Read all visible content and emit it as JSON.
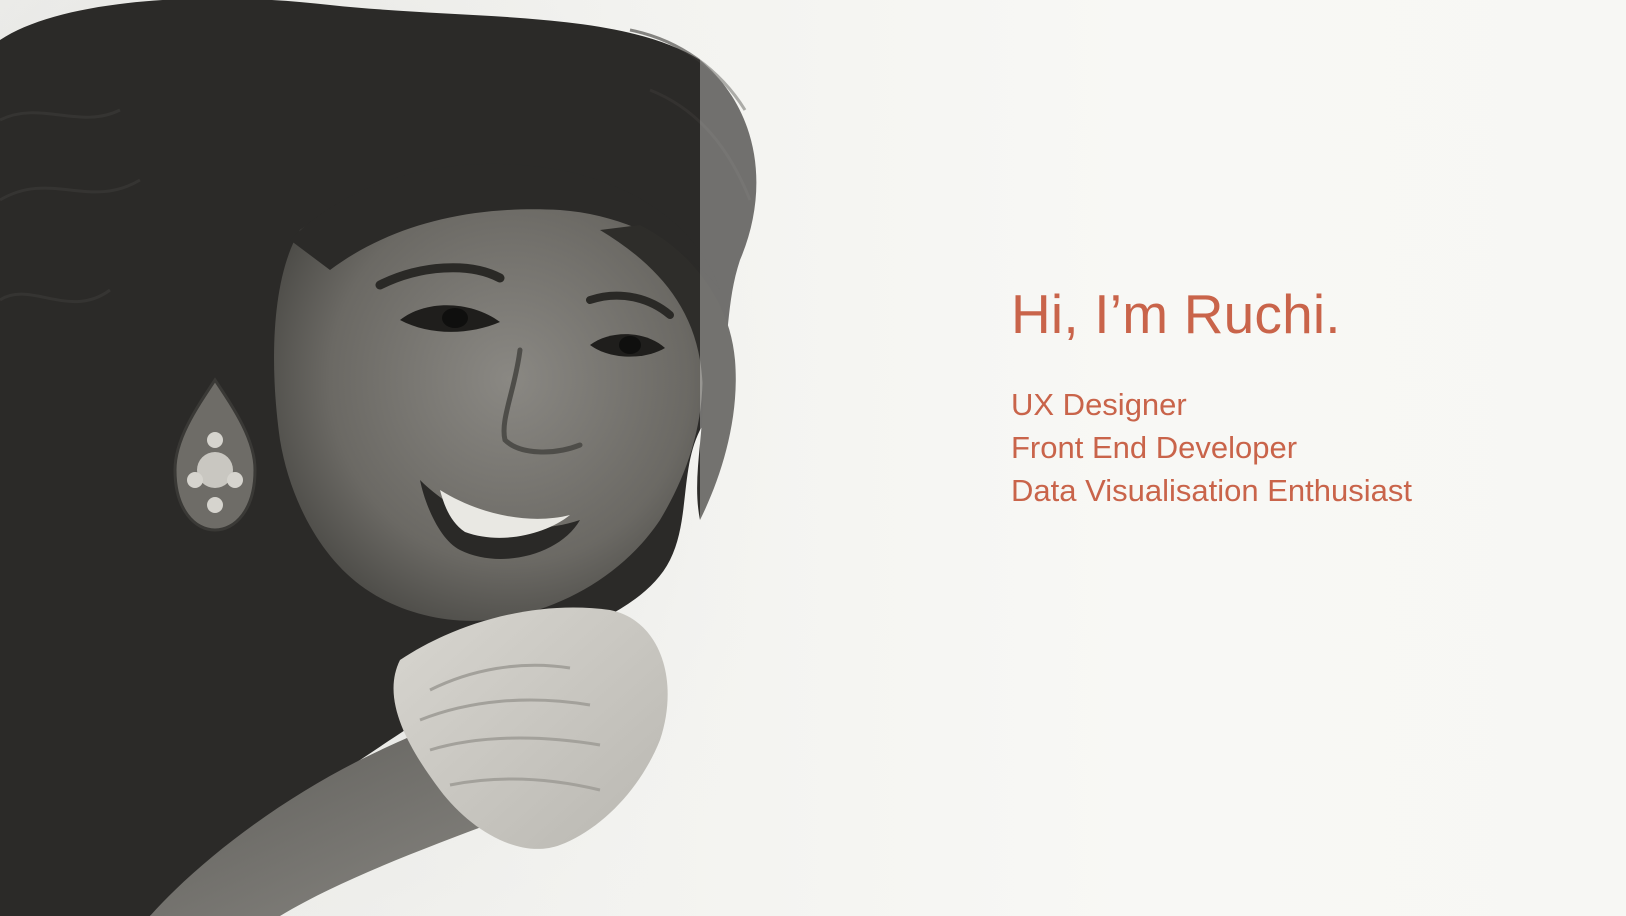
{
  "hero": {
    "greeting": "Hi, I’m Ruchi.",
    "roles": [
      "UX Designer",
      "Front End Developer",
      "Data Visualisation Enthusiast"
    ],
    "photo_alt_icon": "portrait-photo"
  },
  "colors": {
    "accent": "#c9644a",
    "background": "#f6f6f3",
    "hair": "#2a2a28",
    "skin": "#6f6d68"
  }
}
